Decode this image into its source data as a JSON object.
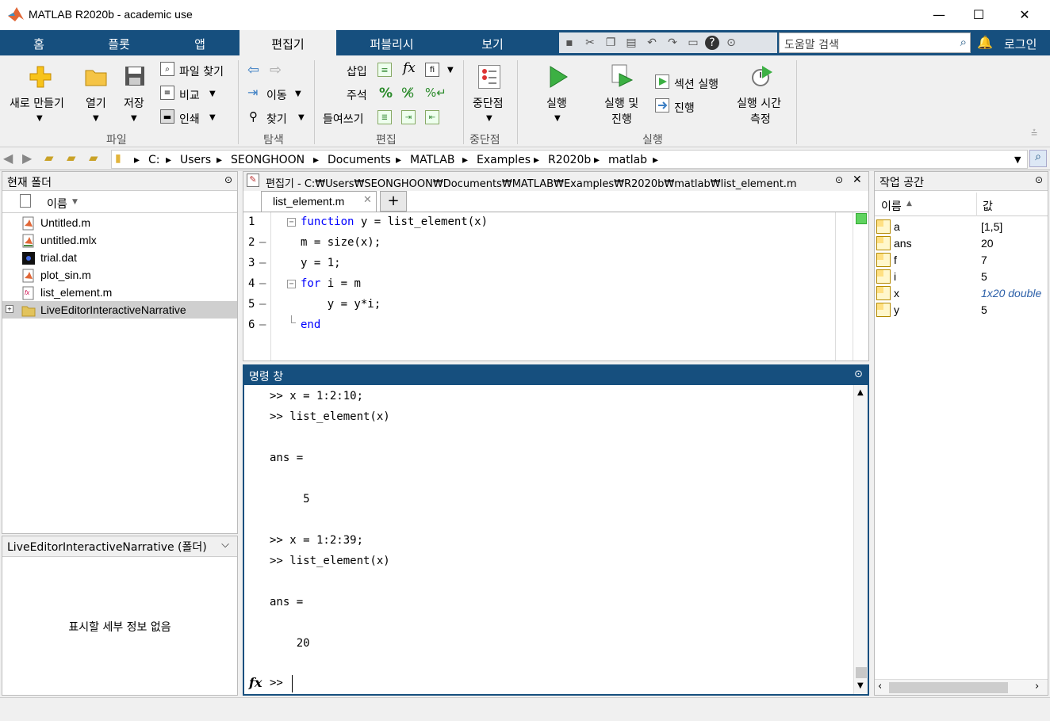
{
  "window": {
    "title": "MATLAB R2020b - academic use",
    "min": "—",
    "max": "☐",
    "close": "✕"
  },
  "tabs": [
    "홈",
    "플롯",
    "앱",
    "편집기",
    "퍼블리시",
    "보기"
  ],
  "search": {
    "placeholder": "도움말 검색"
  },
  "login": "로그인",
  "toolstrip": {
    "file": {
      "new": "새로 만들기",
      "open": "열기",
      "save": "저장",
      "find_files": "파일 찾기",
      "compare": "비교",
      "print": "인쇄",
      "group": "파일"
    },
    "navigate": {
      "goto": "이동",
      "find": "찾기",
      "group": "탐색"
    },
    "edit": {
      "insert": "삽입",
      "comment": "주석",
      "indent": "들여쓰기",
      "group": "편집"
    },
    "breakpoints": {
      "label": "중단점",
      "group": "중단점"
    },
    "run": {
      "run": "실행",
      "run_advance_1": "실행 및",
      "run_advance_2": "진행",
      "run_section": "섹션 실행",
      "advance": "진행",
      "run_time_1": "실행 시간",
      "run_time_2": "측정",
      "group": "실행"
    }
  },
  "address": {
    "crumbs": [
      "C:",
      "Users",
      "SEONGHOON",
      "Documents",
      "MATLAB",
      "Examples",
      "R2020b",
      "matlab"
    ]
  },
  "current_folder": {
    "title": "현재 폴더",
    "col_name": "이름",
    "files": [
      {
        "name": "Untitled.m",
        "icon": "m-file-icon"
      },
      {
        "name": "untitled.mlx",
        "icon": "mlx-file-icon"
      },
      {
        "name": "trial.dat",
        "icon": "dat-file-icon"
      },
      {
        "name": "plot_sin.m",
        "icon": "m-file-icon"
      },
      {
        "name": "list_element.m",
        "icon": "function-file-icon"
      },
      {
        "name": "LiveEditorInteractiveNarrative",
        "icon": "folder-icon"
      }
    ]
  },
  "details": {
    "title": "LiveEditorInteractiveNarrative  (폴더)",
    "empty": "표시할 세부 정보 없음"
  },
  "editor": {
    "title": "편집기 - C:₩Users₩SEONGHOON₩Documents₩MATLAB₩Examples₩R2020b₩matlab₩list_element.m",
    "tab": "list_element.m",
    "lines": [
      {
        "n": "1",
        "kw": "function",
        "rest": " y = list_element(x)",
        "dash": ""
      },
      {
        "n": "2",
        "kw": "",
        "rest": "m = size(x);",
        "dash": "—"
      },
      {
        "n": "3",
        "kw": "",
        "rest": "y = 1;",
        "dash": "—"
      },
      {
        "n": "4",
        "kw": "for",
        "rest": " i = m",
        "dash": "—"
      },
      {
        "n": "5",
        "kw": "",
        "rest": "    y = y*i;",
        "dash": "—"
      },
      {
        "n": "6",
        "kw": "end",
        "rest": "",
        "dash": "—"
      }
    ]
  },
  "command_window": {
    "title": "명령 창",
    "lines": [
      ">> x = 1:2:10;",
      ">> list_element(x)",
      "",
      "ans =",
      "",
      "     5",
      "",
      ">> x = 1:2:39;",
      ">> list_element(x)",
      "",
      "ans =",
      "",
      "    20",
      ""
    ],
    "prompt": ">>",
    "fx": "fx"
  },
  "workspace": {
    "title": "작업 공간",
    "col_name": "이름",
    "col_value": "값",
    "vars": [
      {
        "name": "a",
        "value": "[1,5]"
      },
      {
        "name": "ans",
        "value": "20"
      },
      {
        "name": "f",
        "value": "7"
      },
      {
        "name": "i",
        "value": "5"
      },
      {
        "name": "x",
        "value": "1x20 double"
      },
      {
        "name": "y",
        "value": "5"
      }
    ]
  }
}
